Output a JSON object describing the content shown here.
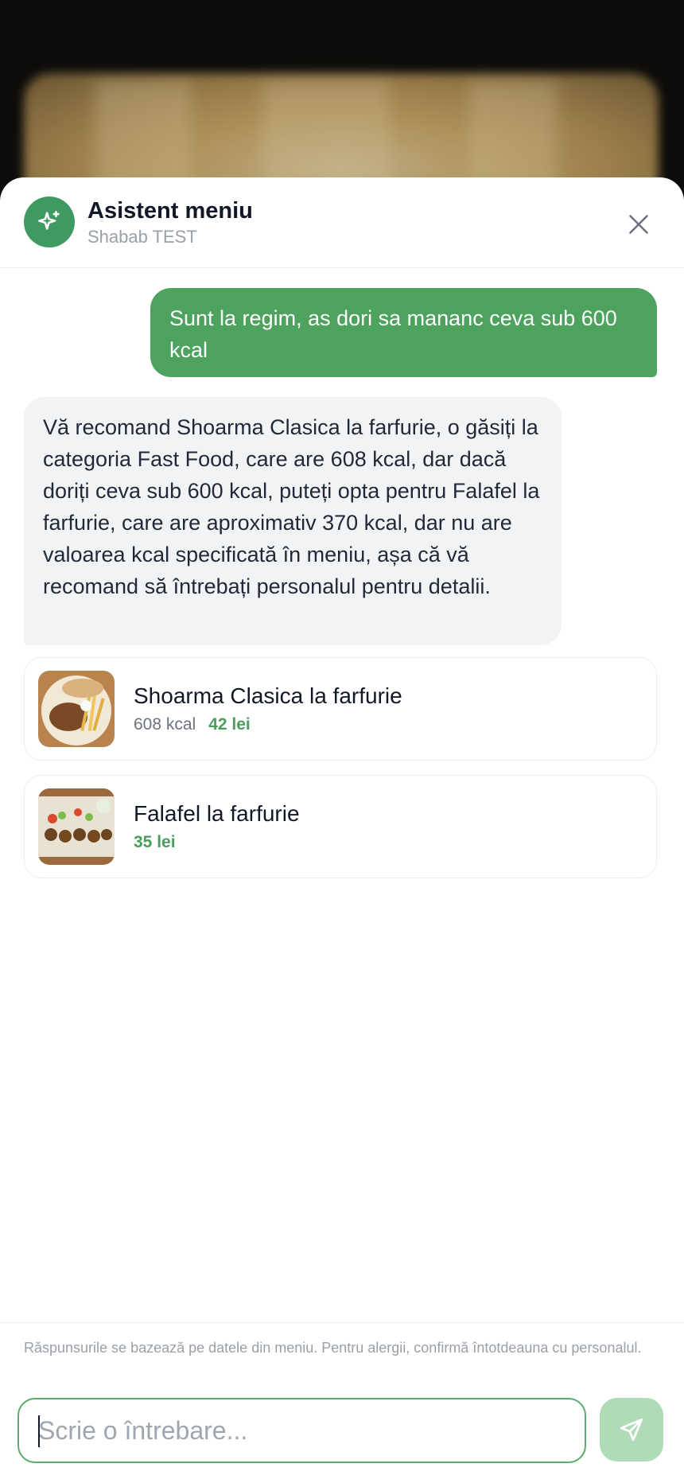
{
  "header": {
    "title": "Asistent meniu",
    "subtitle": "Shabab TEST"
  },
  "messages": {
    "user": "Sunt la regim, as dori sa mananc ceva sub 600 kcal",
    "assistant": "Vă recomand Shoarma Clasica la farfurie, o găsiți la categoria Fast Food, care are 608 kcal, dar dacă doriți ceva sub 600 kcal, puteți opta pentru Falafel la farfurie, care are aproximativ 370 kcal, dar nu are valoarea kcal specificată în meniu, așa că vă recomand să întrebați personalul pentru detalii."
  },
  "cards": [
    {
      "name": "Shoarma Clasica la farfurie",
      "kcal": "608 kcal",
      "price": "42 lei"
    },
    {
      "name": "Falafel la farfurie",
      "kcal": "",
      "price": "35 lei"
    }
  ],
  "footer": {
    "disclaimer": "Răspunsurile se bazează pe datele din meniu. Pentru alergii, confirmă întotdeauna cu personalul.",
    "input_placeholder": "Scrie o întrebare..."
  },
  "icons": {
    "avatar": "sparkles-icon",
    "close": "close-icon",
    "send": "send-icon"
  },
  "colors": {
    "accent": "#4da35e",
    "send_disabled": "#aedcb6",
    "price": "#4a9d5b"
  }
}
